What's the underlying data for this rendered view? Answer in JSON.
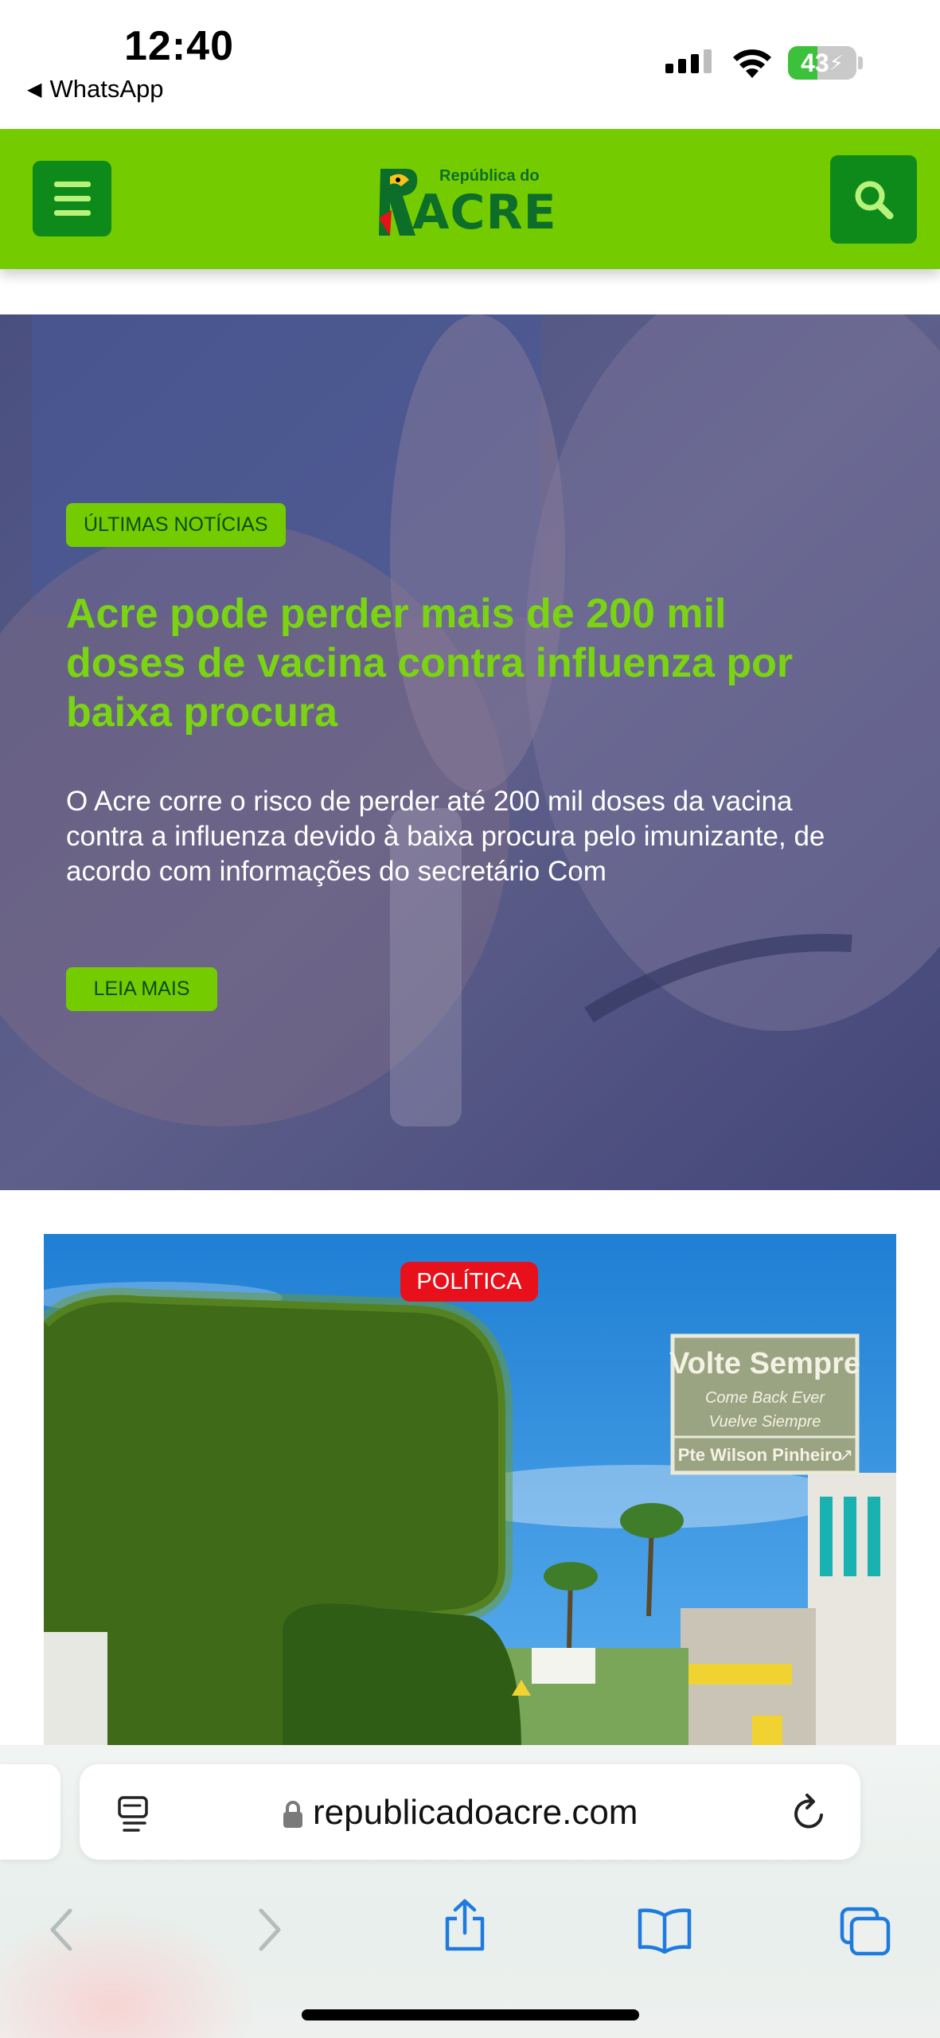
{
  "status_bar": {
    "time": "12:40",
    "back_app": "WhatsApp",
    "battery_level": "43",
    "battery_percent": 43
  },
  "site_header": {
    "logo_small": "República do",
    "logo_big": "ACRE",
    "icons": [
      "menu-icon",
      "search-icon"
    ],
    "colors": {
      "bar": "#74cc00",
      "buttons": "#0d8a1a"
    }
  },
  "hero": {
    "tag": "ÚLTIMAS NOTÍCIAS",
    "title": "Acre pode perder mais de 200 mil doses de vacina contra influenza por baixa procura",
    "excerpt": "O Acre corre o risco de perder até 200 mil doses da vacina contra a influenza devido à baixa procura pelo imunizante, de acordo com informações do secretário Com",
    "read_more": "LEIA MAIS"
  },
  "card2": {
    "sign_title": "Volte Sempre",
    "sign_line2": "Come Back Ever",
    "sign_line3": "Vuelve Siempre",
    "sign_line4": "Pte Wilson Pinheiro",
    "category": "POLÍTICA"
  },
  "browser": {
    "url": "republicadoacre.com",
    "icons": [
      "reader-icon",
      "lock-icon",
      "reload-icon",
      "back-icon",
      "forward-icon",
      "share-icon",
      "bookmarks-icon",
      "tabs-icon"
    ]
  }
}
